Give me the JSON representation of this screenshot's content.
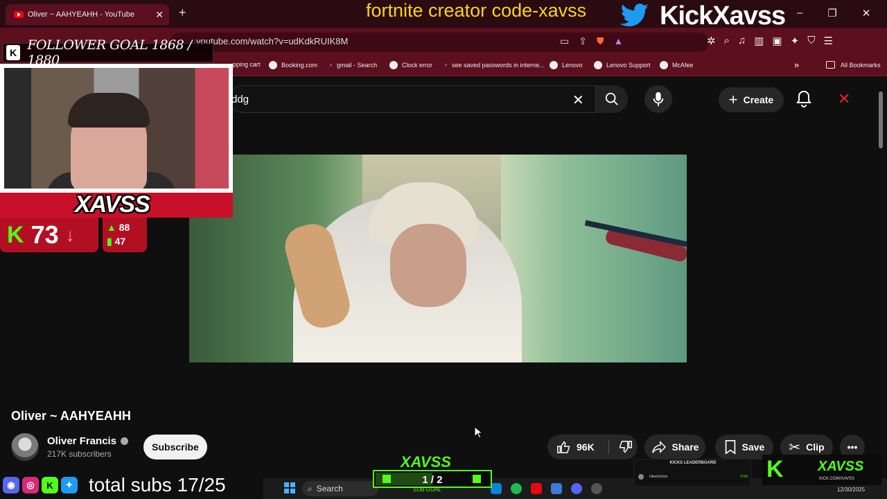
{
  "browser": {
    "tab_title": "Oliver ~ AAHYEAHH - YouTube",
    "new_tab": "+",
    "url": "youtube.com/watch?v=udKdkRUIK8M",
    "window_controls": [
      "–",
      "❐",
      "✕"
    ],
    "bookmarks": [
      "Shopping cart",
      "Booking.com",
      "gmail - Search",
      "Clock error",
      "see saved passwords in interne...",
      "Lenovo",
      "Lenovo Support",
      "McAfee"
    ],
    "bookmarks_visible_first": "pping cart",
    "all_bookmarks": "All Bookmarks",
    "more_chevron": "»"
  },
  "overlay": {
    "ticker": "fortnite creator code-xavss",
    "kick_handle": "KickXavss",
    "follower_goal": "FOLLOWER GOAL 1868 / 1880",
    "follower_goal_k": "K",
    "streamer_name": "XAVSS",
    "viewers": "73",
    "viewer_arrow": "↓",
    "stat_up": "88",
    "stat_bar": "47",
    "total_subs": "total subs 17/25",
    "sub_goal_logo": "XAVSS",
    "sub_goal_value": "1 / 2",
    "sub_goal_fraction": 0.5,
    "sub_goal_label": "SUB GOAL",
    "leaderboard_title": "KICKS LEADERBOARD",
    "leaderboard_user": "hittwitchfork",
    "leaderboard_count": "1743",
    "kick_badge_name": "XAVSS",
    "kick_badge_url": "KICK.COM/XAVSS"
  },
  "youtube": {
    "search_value": "ddg",
    "clear": "✕",
    "create_label": "Create",
    "video_title": "Oliver ~ AAHYEAHH",
    "channel_name": "Oliver Francis",
    "subscribers": "217K subscribers",
    "subscribe_label": "Subscribe",
    "likes": "96K",
    "share_label": "Share",
    "save_label": "Save",
    "clip_label": "Clip",
    "more": "•••"
  },
  "taskbar": {
    "search_label": "Search",
    "date": "12/30/2025"
  },
  "colors": {
    "accent_red": "#c9102a",
    "kick_green": "#53fc18",
    "ticker_yellow": "#f6d51b",
    "browser_bg": "#5c0f1d"
  },
  "icons": [
    "youtube-icon",
    "search-icon",
    "mic-icon",
    "bell-icon",
    "like-icon",
    "dislike-icon",
    "share-icon",
    "save-icon",
    "clip-icon",
    "twitter-icon",
    "discord-icon",
    "instagram-icon",
    "kick-icon",
    "windows-icon"
  ]
}
